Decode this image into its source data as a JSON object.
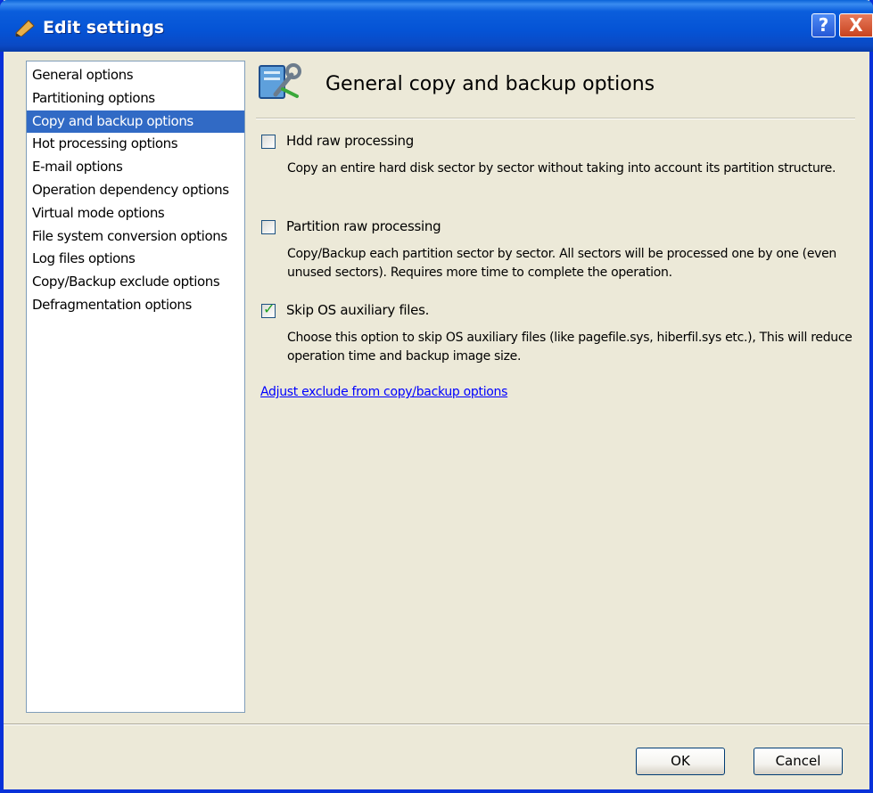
{
  "window": {
    "title": "Edit settings",
    "help_label": "?",
    "close_label": "X"
  },
  "sidebar": {
    "items": [
      {
        "label": "General options"
      },
      {
        "label": "Partitioning options"
      },
      {
        "label": "Copy and backup options",
        "selected": true
      },
      {
        "label": "Hot processing options"
      },
      {
        "label": "E-mail options"
      },
      {
        "label": "Operation dependency options"
      },
      {
        "label": "Virtual mode options"
      },
      {
        "label": "File system conversion options"
      },
      {
        "label": "Log files options"
      },
      {
        "label": "Copy/Backup exclude options"
      },
      {
        "label": "Defragmentation options"
      }
    ]
  },
  "main": {
    "header_title": "General copy and backup options",
    "options": [
      {
        "label": "Hdd raw processing",
        "checked": false,
        "description": "Copy an entire hard disk sector by sector without taking into account its partition structure."
      },
      {
        "label": "Partition raw processing",
        "checked": false,
        "description": "Copy/Backup each partition sector by sector. All sectors will be processed one by one (even unused sectors). Requires more time to complete the operation."
      },
      {
        "label": "Skip OS auxiliary files.",
        "checked": true,
        "description": "Choose this option to skip OS auxiliary files (like pagefile.sys, hiberfil.sys etc.), This will reduce operation time and backup image size."
      }
    ],
    "link": "Adjust exclude from copy/backup options"
  },
  "footer": {
    "ok_label": "OK",
    "cancel_label": "Cancel"
  },
  "colors": {
    "titlebar": "#0553D5",
    "selection": "#316AC5",
    "dialog_bg": "#ECE9D8",
    "link": "#0000FF",
    "check": "#21A121"
  }
}
